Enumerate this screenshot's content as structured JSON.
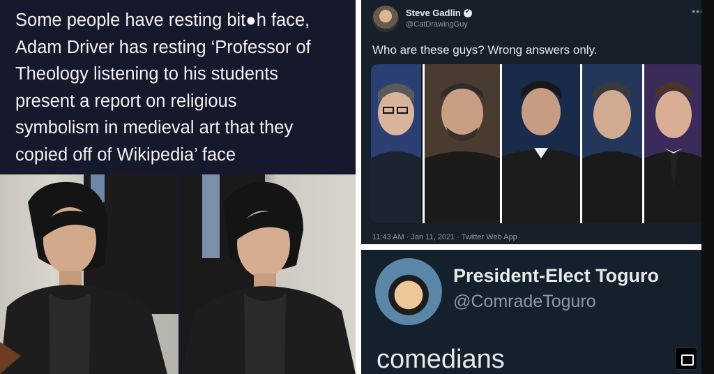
{
  "left_post": {
    "lines": [
      "Some people have resting bit●h face,",
      "Adam Driver has resting ‘Professor of",
      "Theology listening to his students",
      "present a report on religious",
      "symbolism in medieval art that they",
      "copied off of Wikipedia’ face"
    ]
  },
  "tweet": {
    "author": "Steve Gadlin",
    "handle": "@CatDrawingGuy",
    "more_icon": "ellipsis-icon",
    "text": "Who are these guys? Wrong answers only.",
    "meta": "11:43 AM · Jan 11, 2021 · Twitter Web App",
    "accent": "#e7e9ea"
  },
  "reply": {
    "name": "President-Elect Toguro",
    "handle": "@ComradeToguro",
    "text": "comedians",
    "image_icon": "image-icon"
  },
  "colors": {
    "left_bg": "#15192b",
    "tweet_bg": "#15202b",
    "divider": "#ffffff"
  }
}
